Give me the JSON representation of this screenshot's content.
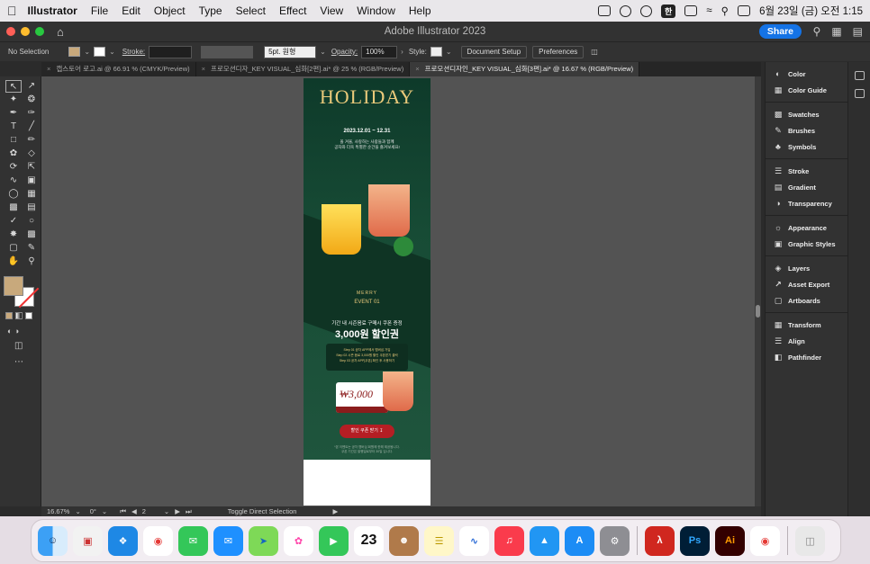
{
  "menubar": {
    "items": [
      "Illustrator",
      "File",
      "Edit",
      "Object",
      "Type",
      "Select",
      "Effect",
      "View",
      "Window",
      "Help"
    ],
    "ime_badge": "한",
    "clock": "6월 23일 (금) 오전 1:15"
  },
  "titlebar": {
    "title": "Adobe Illustrator 2023",
    "share_label": "Share"
  },
  "control": {
    "selection": "No Selection",
    "stroke_label": "Stroke:",
    "brush": "5pt. 원형",
    "opacity_label": "Opacity:",
    "opacity_value": "100%",
    "style_label": "Style:",
    "document_setup": "Document Setup",
    "preferences": "Preferences"
  },
  "tabs": [
    {
      "label": "캡스토어 로고.ai @ 66.91 % (CMYK/Preview)",
      "active": false
    },
    {
      "label": "프로모션디자_KEY VISUAL_심화[2편].ai* @ 25 % (RGB/Preview)",
      "active": false
    },
    {
      "label": "프로모션디자인_KEY VISUAL_심화[3편].ai* @ 16.67 % (RGB/Preview)",
      "active": true
    }
  ],
  "panels": {
    "group1": [
      "Color",
      "Color Guide"
    ],
    "group2": [
      "Swatches",
      "Brushes",
      "Symbols"
    ],
    "group3": [
      "Stroke",
      "Gradient",
      "Transparency"
    ],
    "group4": [
      "Appearance",
      "Graphic Styles"
    ],
    "group5": [
      "Layers",
      "Asset Export",
      "Artboards"
    ],
    "group6": [
      "Transform",
      "Align",
      "Pathfinder"
    ]
  },
  "status": {
    "zoom": "16.67%",
    "rotate": "0°",
    "artboard_index": "2",
    "tool": "Toggle Direct Selection"
  },
  "design": {
    "headline": "HOLIDAY",
    "date": "2023.12.01 ~ 12.31",
    "sub1": "올 겨울, 사랑하는 사람들과 함께",
    "sub2": "공차와 더욱 특별한 순간을 즐겨보세요!",
    "merry": "MERRY",
    "event": "EVENT 01",
    "line1": "기간 내 시즌음료 구매시 쿠폰 증정",
    "big": "3,000원 할인권",
    "step1": "Step 01 공차 APP에서 멤버십 가입",
    "step2": "Step 02 시즌 음료 3,000원 할인 쿠폰받기 클릭",
    "step3": "Step 03 공차 APP[쿠폰] 확인 후 사용하기",
    "price": "₩3,000",
    "button": "할인 쿠폰 받기",
    "fine1": "*본 이벤트는 공차 멤버십 회원에 한해 제공됩니다.",
    "fine2": "쿠폰 기간은 발행일로부터 30일 입니다."
  },
  "colors": {
    "accent": "#1473e6",
    "fill_swatch": "#c8a97c",
    "design_green": "#174b35",
    "design_gold": "#e9c97a",
    "design_red": "#b51e24"
  }
}
